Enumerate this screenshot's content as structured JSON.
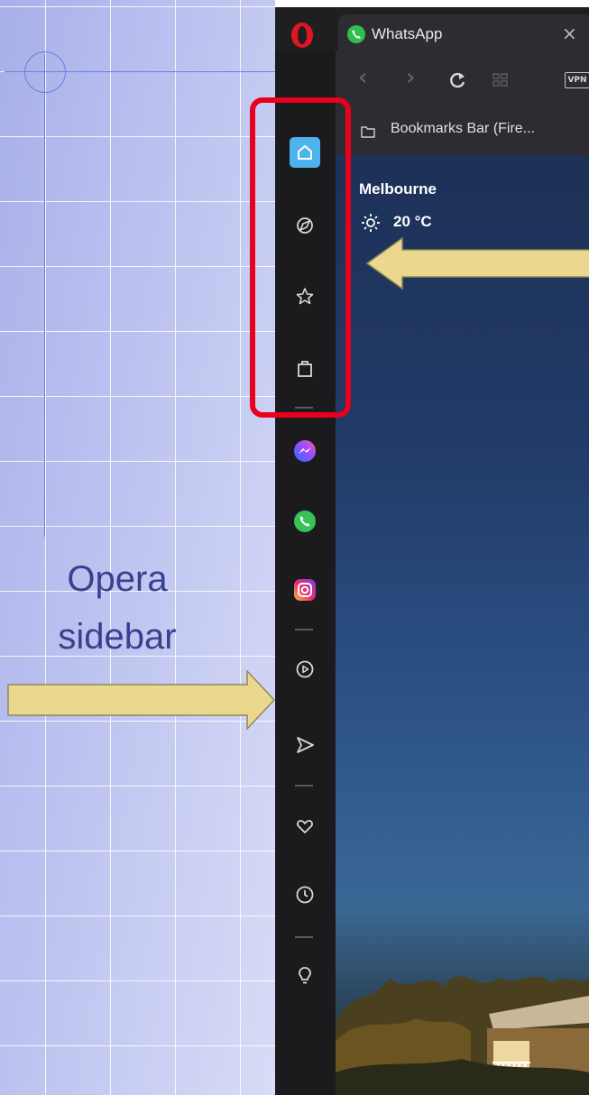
{
  "slide": {
    "label_line1": "Opera",
    "label_line2": "sidebar",
    "accent_color": "#3b3f8f",
    "arrow_color": "#ecd78e"
  },
  "browser": {
    "tab": {
      "title": "WhatsApp",
      "icon": "whatsapp-icon",
      "close": "×"
    },
    "toolbar": {
      "back": "‹",
      "forward": "›",
      "reload": "C",
      "vpn": "VPN"
    },
    "bookmarks_bar": {
      "label": "Bookmarks Bar (Fire..."
    },
    "sidebar": {
      "items": [
        {
          "name": "home-icon",
          "active": true
        },
        {
          "name": "clock-compass-icon"
        },
        {
          "name": "star-icon"
        },
        {
          "name": "shopping-bag-icon"
        },
        {
          "name": "messenger-icon"
        },
        {
          "name": "whatsapp-icon"
        },
        {
          "name": "instagram-icon"
        },
        {
          "name": "player-icon"
        },
        {
          "name": "send-icon"
        },
        {
          "name": "heart-icon"
        },
        {
          "name": "history-icon"
        },
        {
          "name": "lightbulb-icon"
        }
      ]
    },
    "weather": {
      "city": "Melbourne",
      "temperature": "20 °C"
    }
  }
}
